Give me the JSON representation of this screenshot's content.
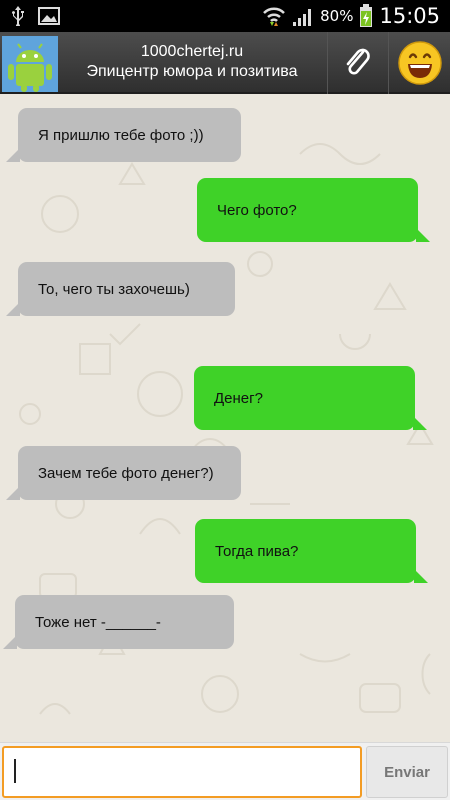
{
  "status_bar": {
    "battery_percent": "80%",
    "time": "15:05",
    "icons": [
      "usb-icon",
      "image-icon",
      "wifi-icon",
      "signal-icon",
      "battery-charging-icon"
    ]
  },
  "header": {
    "title": "1000chertej.ru",
    "subtitle": "Эпицентр юмора и позитива",
    "avatar": "android-robot-icon",
    "attach_icon": "paperclip-icon",
    "emoji_icon": "smiley-icon"
  },
  "messages": [
    {
      "side": "in",
      "text": "Я пришлю тебе фото ;))"
    },
    {
      "side": "out",
      "text": "Чего фото?"
    },
    {
      "side": "in",
      "text": "То, чего ты захочешь)"
    },
    {
      "side": "out",
      "text": "Денег?"
    },
    {
      "side": "in",
      "text": "Зачем тебе фото денег?)"
    },
    {
      "side": "out",
      "text": "Тогда пива?"
    },
    {
      "side": "in",
      "text": "Тоже нет -______-"
    }
  ],
  "composer": {
    "value": "",
    "send_label": "Enviar"
  },
  "colors": {
    "incoming_bubble": "#bdbdbd",
    "outgoing_bubble": "#3fd228",
    "input_focus": "#f39c24"
  }
}
